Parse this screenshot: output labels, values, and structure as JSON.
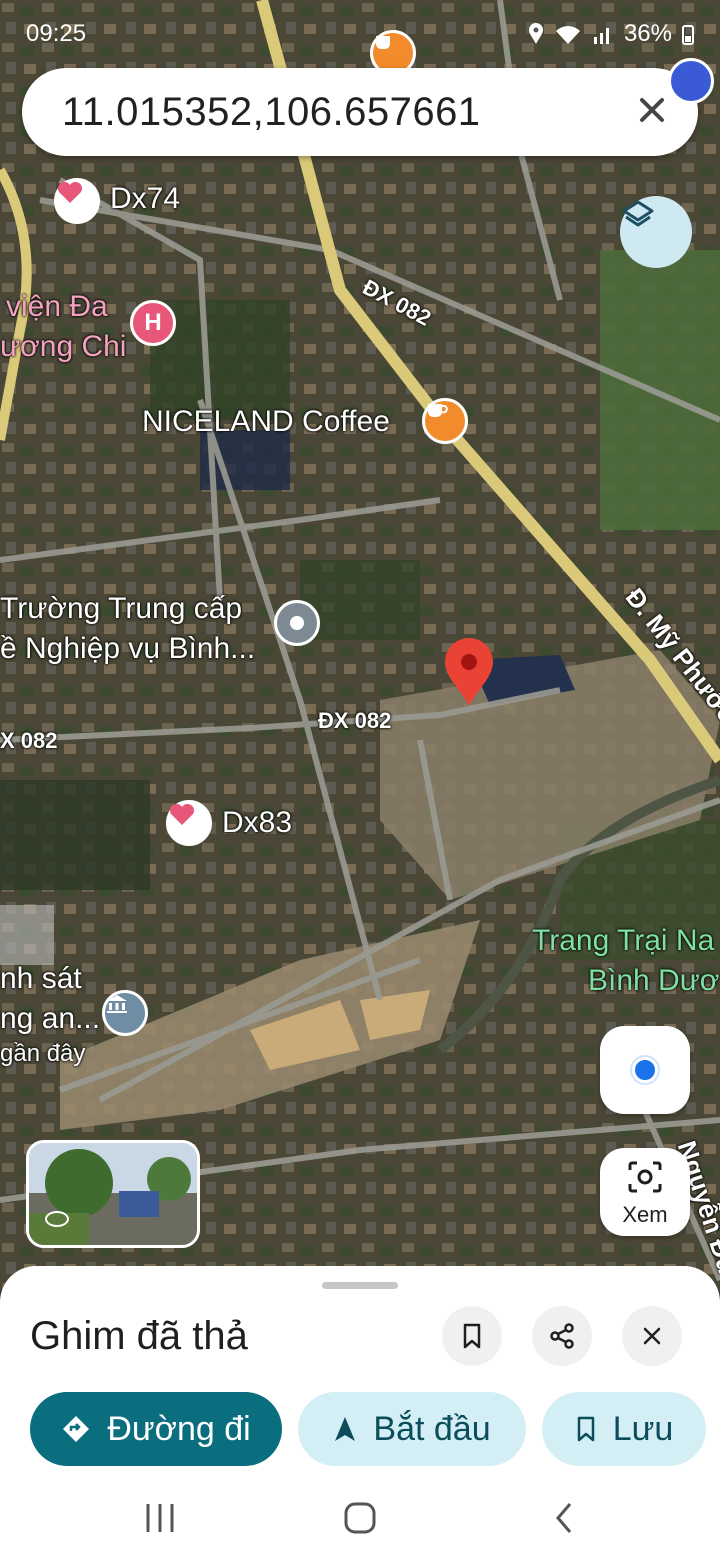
{
  "status_bar": {
    "time": "09:25",
    "battery": "36%"
  },
  "search": {
    "query": "11.015352,106.657661"
  },
  "map": {
    "places": [
      {
        "key": "dx74",
        "label": "Dx74",
        "icon": "heart-icon"
      },
      {
        "key": "hospital",
        "label_line1": "viện Đa",
        "label_line2": "ương Chi",
        "icon": "hospital-icon"
      },
      {
        "key": "niceland",
        "label": "NICELAND Coffee",
        "icon": "coffee-icon"
      },
      {
        "key": "school",
        "label_line1": "Trường Trung cấp",
        "label_line2": "ề Nghiệp vụ Bình...",
        "icon": "place-icon"
      },
      {
        "key": "dx83",
        "label": "Dx83",
        "icon": "heart-icon"
      },
      {
        "key": "farm",
        "label_line1": "Trang Trại Na",
        "label_line2": "Bình Dươ"
      },
      {
        "key": "police",
        "label_line1": "nh sát",
        "label_line2": "ng an...",
        "label_line3": "gần đây",
        "icon": "government-icon"
      }
    ],
    "roads": {
      "dx082_a": "ĐX 082",
      "dx082_b": "ĐX 082",
      "dx082_c": "X 082",
      "my_phuoc": "Đ. Mỹ Phước",
      "nguyen_duc": "Nguyễn Đức"
    }
  },
  "controls": {
    "lens_label": "Xem"
  },
  "sheet": {
    "title": "Ghim đã thả",
    "directions_label": "Đường đi",
    "start_label": "Bắt đầu",
    "save_label": "Lưu"
  },
  "colors": {
    "accent": "#0b6e7e",
    "pill_light": "#d3eef5",
    "pin": "#ea4335",
    "heart": "#e8577a"
  }
}
